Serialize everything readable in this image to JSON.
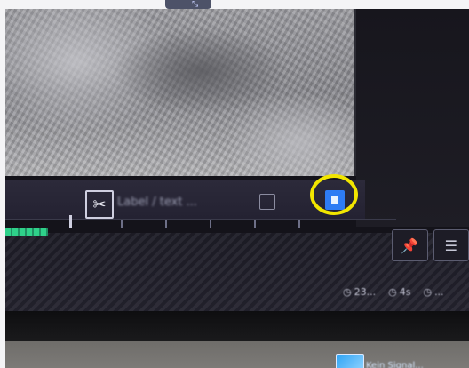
{
  "app": {
    "top_tab_icon": "maximize-arrow-icon"
  },
  "video": {
    "label": "camera preview"
  },
  "toolbar": {
    "cut_icon": "✂",
    "label_field_value": "Label / text ...",
    "record_icon": "screen-record-icon"
  },
  "side_panel": {
    "buttons": [
      {
        "icon": "pin-icon",
        "glyph": "📌"
      },
      {
        "icon": "list-icon",
        "glyph": "☰"
      }
    ]
  },
  "timecodes": [
    {
      "icon": "clock-icon",
      "text": "23..."
    },
    {
      "icon": "clock-icon",
      "text": "4s"
    },
    {
      "icon": "clock-icon",
      "text": "..."
    }
  ],
  "taskbar": {
    "tray_label": "Kein Signal..."
  },
  "colors": {
    "highlight": "#f2e600",
    "record_blue": "#2e7cf4",
    "progress_green": "#2fd18a"
  },
  "progress": {
    "fraction": 0.09
  }
}
